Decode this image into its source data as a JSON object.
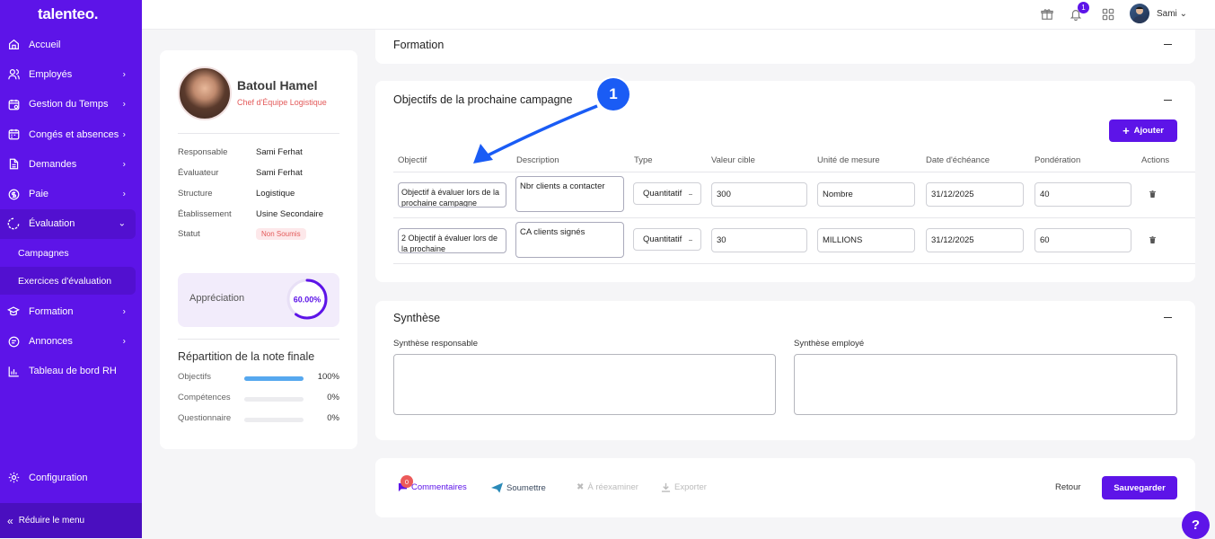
{
  "brand": "talenteo.",
  "nav": {
    "items": [
      {
        "label": "Accueil",
        "icon": "home-icon"
      },
      {
        "label": "Employés",
        "icon": "users-icon"
      },
      {
        "label": "Gestion du Temps",
        "icon": "calendar-clock-icon"
      },
      {
        "label": "Congés et absences",
        "icon": "calendar-icon"
      },
      {
        "label": "Demandes",
        "icon": "document-icon"
      },
      {
        "label": "Paie",
        "icon": "coin-icon"
      },
      {
        "label": "Évaluation",
        "icon": "evaluation-icon"
      }
    ],
    "sub": [
      "Campagnes",
      "Exercices d'évaluation"
    ],
    "more": [
      {
        "label": "Formation",
        "icon": "graduation-icon"
      },
      {
        "label": "Annonces",
        "icon": "announce-icon"
      },
      {
        "label": "Tableau de bord RH",
        "icon": "chart-icon"
      }
    ],
    "config": "Configuration",
    "collapse": "Réduire le menu"
  },
  "topbar": {
    "notif_count": "1",
    "user": "Sami"
  },
  "profile": {
    "name": "Batoul Hamel",
    "role": "Chef d'Équipe Logistique",
    "info": [
      {
        "k": "Responsable",
        "v": "Sami Ferhat"
      },
      {
        "k": "Évaluateur",
        "v": "Sami Ferhat"
      },
      {
        "k": "Structure",
        "v": "Logistique"
      },
      {
        "k": "Établissement",
        "v": "Usine Secondaire"
      },
      {
        "k": "Statut",
        "v": "Non Soumis"
      }
    ],
    "appreciation_label": "Appréciation",
    "appreciation_value": "60.00%",
    "appreciation_fraction": 0.6,
    "repartition_title": "Répartition de la note finale",
    "repartition": [
      {
        "label": "Objectifs",
        "pct": "100%",
        "fraction": 1.0
      },
      {
        "label": "Compétences",
        "pct": "0%",
        "fraction": 0
      },
      {
        "label": "Questionnaire",
        "pct": "0%",
        "fraction": 0
      }
    ]
  },
  "formation_title": "Formation",
  "objectives": {
    "title": "Objectifs de la prochaine campagne",
    "add_label": "Ajouter",
    "headers": [
      "Objectif",
      "Description",
      "Type",
      "Valeur cible",
      "Unité de mesure",
      "Date d'échéance",
      "Pondération",
      "Actions"
    ],
    "rows": [
      {
        "objectif": "Objectif à évaluer lors de la prochaine campagne",
        "description": "Nbr clients a contacter",
        "type": "Quantitatif",
        "valeur": "300",
        "unite": "Nombre",
        "date": "31/12/2025",
        "ponderation": "40"
      },
      {
        "objectif": "2 Objectif à évaluer lors de la prochaine",
        "description": "CA clients signés",
        "type": "Quantitatif",
        "valeur": "30",
        "unite": "MILLIONS",
        "date": "31/12/2025",
        "ponderation": "60"
      }
    ]
  },
  "synthese": {
    "title": "Synthèse",
    "responsable": "Synthèse responsable",
    "employe": "Synthèse employé"
  },
  "actions": {
    "comment_count": "0",
    "comments": "Commentaires",
    "submit": "Soumettre",
    "reexam": "À réexaminer",
    "export": "Exporter",
    "back": "Retour",
    "save": "Sauvegarder"
  },
  "annotation": {
    "marker": "1"
  },
  "help": "?",
  "colors": {
    "accent": "#5d14e8",
    "danger": "#e35b5b",
    "progress": "#56a8ef",
    "marker": "#1a5cf5"
  }
}
